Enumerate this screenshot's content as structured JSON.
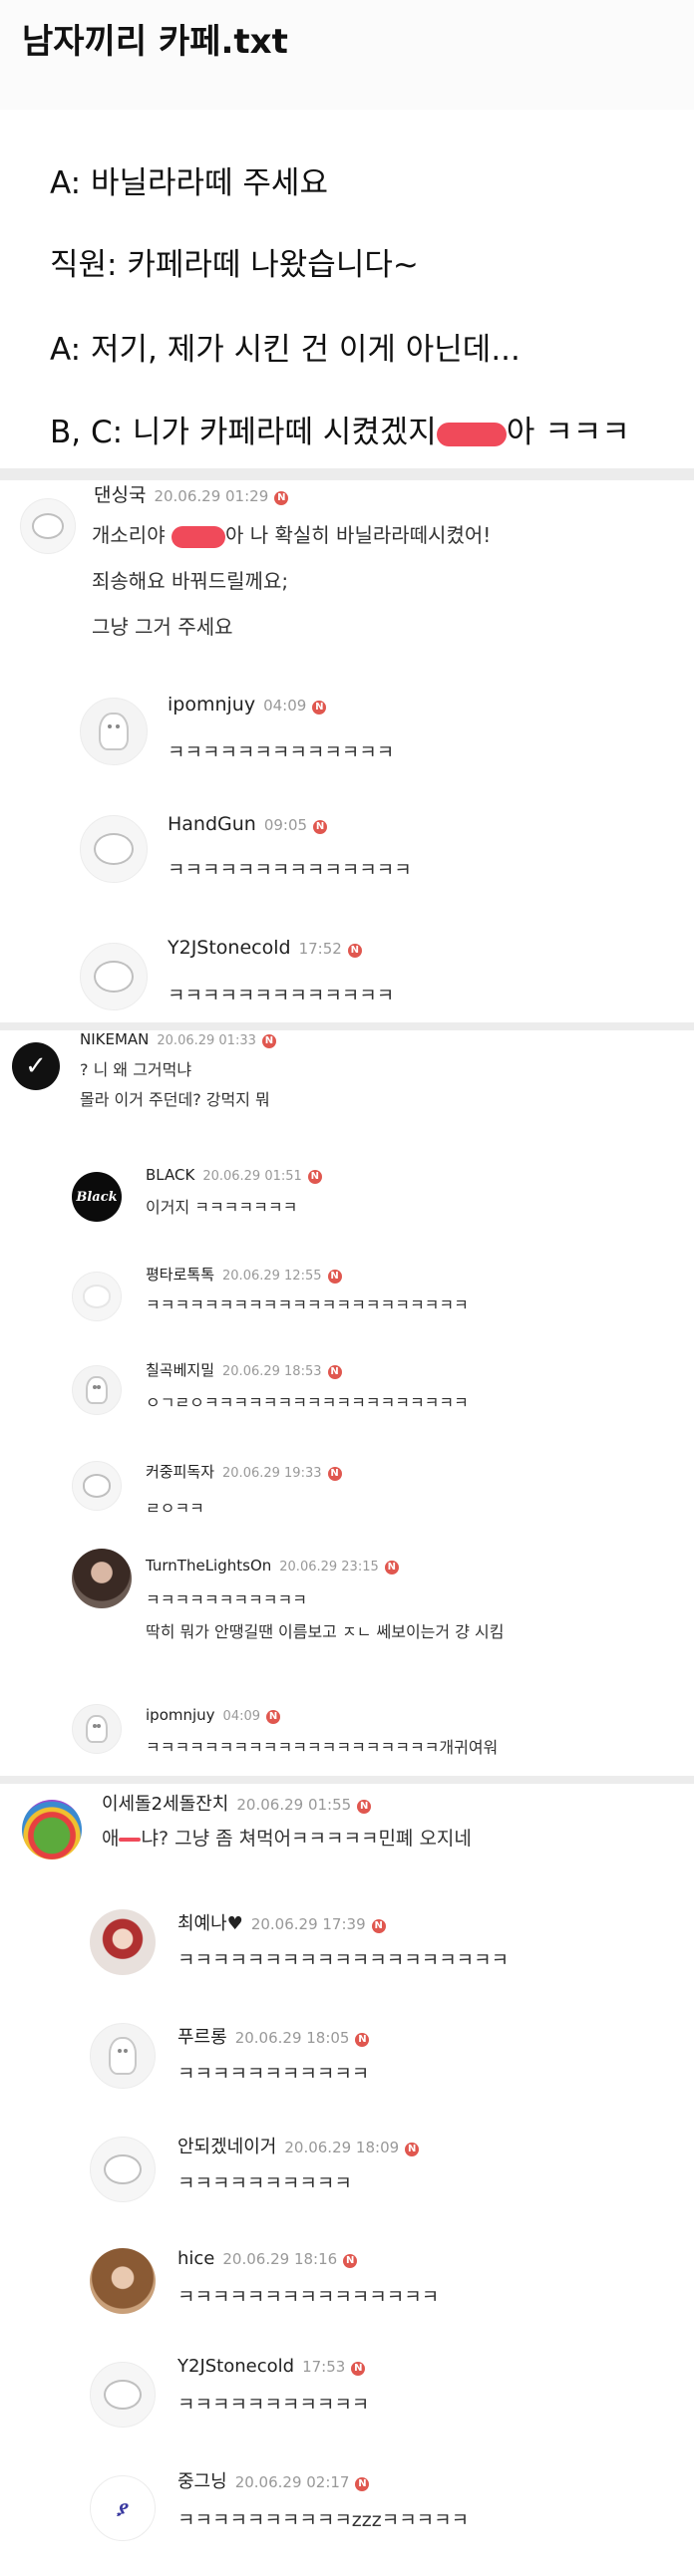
{
  "title": "남자끼리 카페.txt",
  "dialog": [
    {
      "text": "A: 바닐라라떼 주세요"
    },
    {
      "text": "직원: 카페라떼 나왔습니다~"
    },
    {
      "text": "A: 저기, 제가 시킨 건 이게 아닌데..."
    },
    {
      "text_before": "B, C: 니가 카페라떼 시켰겠지",
      "text_after": "아 ㅋㅋㅋ"
    }
  ],
  "threads": [
    {
      "author": "댄싱국",
      "time": "20.06.29 01:29",
      "lines": {
        "l1_before": "개소리야",
        "l1_after": "아 나 확실히 바닐라라떼시켰어!",
        "l2": "죄송해요 바꿔드릴께요;",
        "l3": "그냥 그거 주세요"
      },
      "replies": [
        {
          "author": "ipomnjuy",
          "time": "04:09",
          "text": "ㅋㅋㅋㅋㅋㅋㅋㅋㅋㅋㅋㅋㅋ"
        },
        {
          "author": "HandGun",
          "time": "09:05",
          "text": "ㅋㅋㅋㅋㅋㅋㅋㅋㅋㅋㅋㅋㅋㅋ"
        },
        {
          "author": "Y2JStonecold",
          "time": "17:52",
          "text": "ㅋㅋㅋㅋㅋㅋㅋㅋㅋㅋㅋㅋㅋ"
        }
      ]
    },
    {
      "author": "NIKEMAN",
      "time": "20.06.29 01:33",
      "lines": {
        "l1": "? 니 왜 그거먹냐",
        "l2": "몰라 이거 주던데? 강먹지 뭐"
      },
      "replies": [
        {
          "author": "BLACK",
          "time": "20.06.29 01:51",
          "text": "이거지 ㅋㅋㅋㅋㅋㅋㅋ"
        },
        {
          "author": "평타로톡톡",
          "time": "20.06.29 12:55",
          "text": "ㅋㅋㅋㅋㅋㅋㅋㅋㅋㅋㅋㅋㅋㅋㅋㅋㅋㅋㅋㅋㅋㅋ"
        },
        {
          "author": "칠곡베지밀",
          "time": "20.06.29 18:53",
          "text": "ㅇㄱㄹㅇㅋㅋㅋㅋㅋㅋㅋㅋㅋㅋㅋㅋㅋㅋㅋㅋㅋㅋ"
        },
        {
          "author": "커중피독자",
          "time": "20.06.29 19:33",
          "text": "ㄹㅇㅋㅋ"
        },
        {
          "author": "TurnTheLightsOn",
          "time": "20.06.29 23:15",
          "text": "ㅋㅋㅋㅋㅋㅋㅋㅋㅋㅋㅋ",
          "text2": "딱히 뭐가 안땡길땐 이름보고 ㅈㄴ 쎄보이는거 걍 시킴"
        },
        {
          "author": "ipomnjuy",
          "time": "04:09",
          "text": "ㅋㅋㅋㅋㅋㅋㅋㅋㅋㅋㅋㅋㅋㅋㅋㅋㅋㅋㅋㅋ개귀여워"
        }
      ]
    },
    {
      "author": "이세돌2세돌잔치",
      "time": "20.06.29 01:55",
      "lines": {
        "l1_before": "애",
        "l1_after": "냐? 그냥 좀 쳐먹어ㅋㅋㅋㅋㅋ민폐 오지네"
      },
      "replies": [
        {
          "author": "최예나♥",
          "time": "20.06.29 17:39",
          "text": "ㅋㅋㅋㅋㅋㅋㅋㅋㅋㅋㅋㅋㅋㅋㅋㅋㅋㅋㅋ"
        },
        {
          "author": "푸르롱",
          "time": "20.06.29 18:05",
          "text": "ㅋㅋㅋㅋㅋㅋㅋㅋㅋㅋㅋ"
        },
        {
          "author": "안되겠네이거",
          "time": "20.06.29 18:09",
          "text": "ㅋㅋㅋㅋㅋㅋㅋㅋㅋㅋ"
        },
        {
          "author": "hice",
          "time": "20.06.29 18:16",
          "text": "ㅋㅋㅋㅋㅋㅋㅋㅋㅋㅋㅋㅋㅋㅋㅋ"
        },
        {
          "author": "Y2JStonecold",
          "time": "17:53",
          "text": "ㅋㅋㅋㅋㅋㅋㅋㅋㅋㅋㅋ"
        },
        {
          "author": "중그닝",
          "time": "20.06.29 02:17",
          "text": "ㅋㅋㅋㅋㅋㅋㅋㅋㅋㅋzzzㅋㅋㅋㅋㅋ"
        }
      ]
    }
  ],
  "badge_glyph": "N",
  "avatar_glyphs": {
    "nike": "✓",
    "black": "Black",
    "boy": "ያ"
  }
}
